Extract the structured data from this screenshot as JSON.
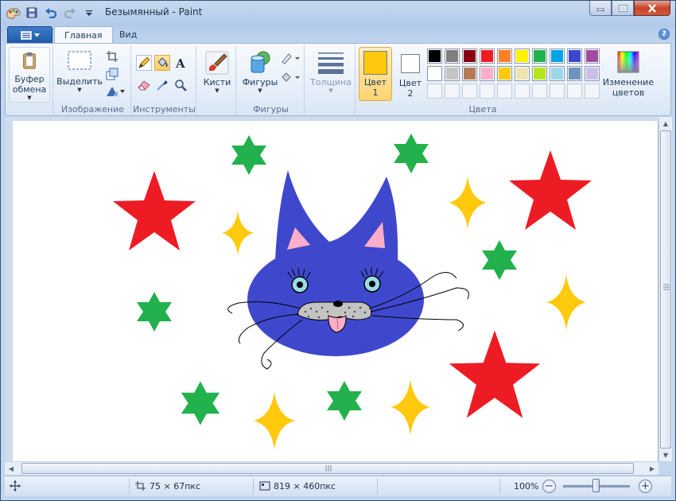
{
  "window": {
    "title": "Безымянный - Paint"
  },
  "ribbon": {
    "tabs": [
      {
        "label": "Главная",
        "active": true
      },
      {
        "label": "Вид",
        "active": false
      }
    ],
    "groups": {
      "clipboard": {
        "button_label": "Буфер обмена",
        "line1": "Буфер",
        "line2": "обмена"
      },
      "image": {
        "label": "Изображение",
        "select_label": "Выделить"
      },
      "tools": {
        "label": "Инструменты"
      },
      "brushes": {
        "label": "Кисти"
      },
      "shapes": {
        "label": "Фигуры",
        "button_label": "Фигуры"
      },
      "size": {
        "label": "Толщина"
      },
      "colors": {
        "label": "Цвета",
        "color1_line1": "Цвет",
        "color1_line2": "1",
        "color2_line1": "Цвет",
        "color2_line2": "2",
        "edit_line1": "Изменение",
        "edit_line2": "цветов",
        "color1_value": "#ffc90e",
        "color2_value": "#ffffff",
        "palette": [
          "#000000",
          "#7f7f7f",
          "#880015",
          "#ed1c24",
          "#ff7f27",
          "#fff200",
          "#22b14c",
          "#00a2e8",
          "#3f48cc",
          "#a349a4",
          "#ffffff",
          "#c3c3c3",
          "#b97a57",
          "#ffaec9",
          "#ffc90e",
          "#efe4b0",
          "#b5e61d",
          "#99d9ea",
          "#7092be",
          "#c8bfe7",
          "",
          "",
          "",
          "",
          "",
          "",
          "",
          "",
          "",
          ""
        ]
      }
    }
  },
  "statusbar": {
    "selection_size": "75 × 67пкс",
    "image_size": "819 × 460пкс",
    "zoom": "100%"
  },
  "drawing": {
    "colors": {
      "red_star": "#ed1c24",
      "green_star": "#22b14c",
      "yellow_sparkle": "#ffc90e",
      "cat_body": "#3f48cc",
      "cat_ears_inner": "#ffaec9",
      "eye_iris": "#99d9ea",
      "muzzle": "#c3c3c3",
      "tongue": "#ffaec9"
    }
  }
}
